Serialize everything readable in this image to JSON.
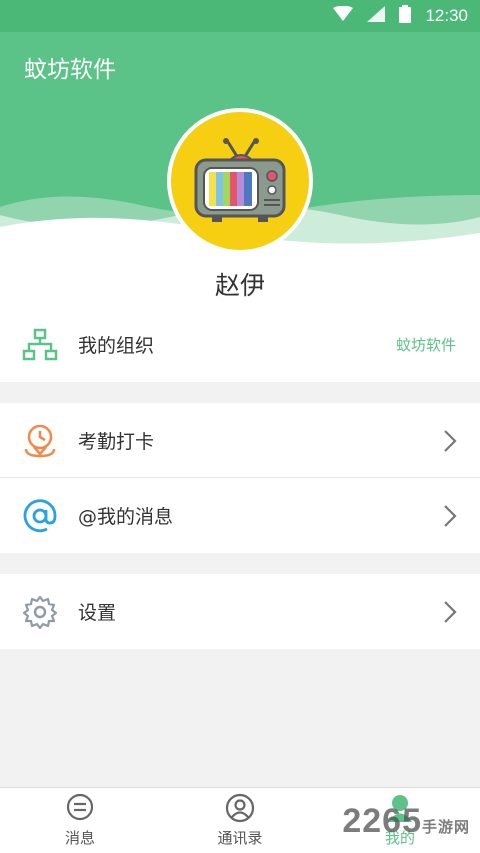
{
  "status_bar": {
    "time": "12:30"
  },
  "header": {
    "app_title": "蚊坊软件"
  },
  "profile": {
    "username": "赵伊"
  },
  "menu": {
    "org": {
      "label": "我的组织",
      "value": "蚊坊软件"
    },
    "attendance": {
      "label": "考勤打卡"
    },
    "mentions": {
      "label": "@我的消息"
    },
    "settings": {
      "label": "设置"
    }
  },
  "tabbar": {
    "messages": "消息",
    "contacts": "通讯录",
    "me": "我的"
  },
  "watermark": {
    "number": "2265",
    "site": "手游网"
  },
  "colors": {
    "primary": "#5cc388",
    "orange": "#f08a4b",
    "blue": "#29a3e0",
    "gray_icon": "#8e9aa6"
  }
}
